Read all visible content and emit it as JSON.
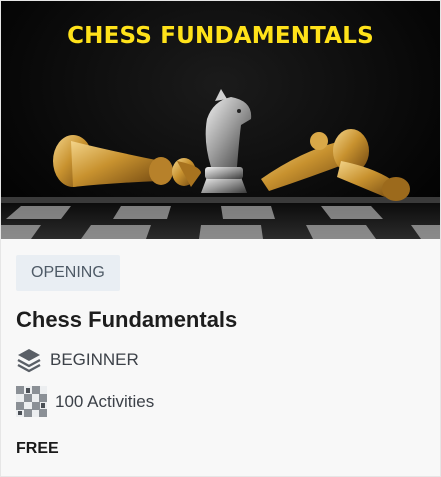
{
  "hero": {
    "title": "CHESS FUNDAMENTALS"
  },
  "course": {
    "category": "OPENING",
    "title": "Chess Fundamentals",
    "level": "BEGINNER",
    "activities": "100 Activities",
    "price": "FREE"
  },
  "icons": {
    "level": "layers-icon",
    "activities": "chessboard-icon"
  },
  "colors": {
    "hero_title": "#ffe21a",
    "tag_bg": "#e9eef3",
    "card_bg": "#f8f8f8"
  }
}
